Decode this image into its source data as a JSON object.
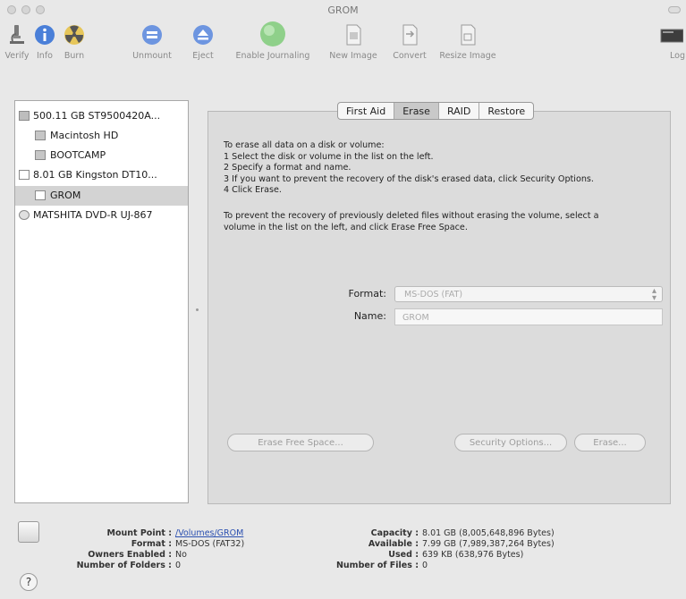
{
  "window": {
    "title": "GROM"
  },
  "toolbar": {
    "verify": "Verify",
    "info": "Info",
    "burn": "Burn",
    "unmount": "Unmount",
    "eject": "Eject",
    "enable_journaling": "Enable Journaling",
    "new_image": "New Image",
    "convert": "Convert",
    "resize_image": "Resize Image",
    "log": "Log"
  },
  "sidebar": {
    "items": [
      {
        "label": "500.11 GB ST9500420A..."
      },
      {
        "label": "Macintosh HD"
      },
      {
        "label": "BOOTCAMP"
      },
      {
        "label": "8.01 GB Kingston DT10..."
      },
      {
        "label": "GROM"
      },
      {
        "label": "MATSHITA DVD-R UJ-867"
      }
    ]
  },
  "tabs": [
    "First Aid",
    "Erase",
    "RAID",
    "Restore"
  ],
  "erase": {
    "instructions": [
      "To erase all data on a disk or volume:",
      "1 Select the disk or volume in the list on the left.",
      "2 Specify a format and name.",
      "3 If you want to prevent the recovery of the disk's erased data, click Security Options.",
      "4 Click Erase."
    ],
    "free_space_note": [
      "To prevent the recovery of previously deleted files without erasing the volume, select a",
      "volume in the list on the left, and click Erase Free Space."
    ],
    "format_label": "Format:",
    "format_value": "MS-DOS (FAT)",
    "name_label": "Name:",
    "name_value": "GROM",
    "erase_free_space_button": "Erase Free Space...",
    "security_options_button": "Security Options...",
    "erase_button": "Erase..."
  },
  "info": {
    "mount_point_label": "Mount Point :",
    "mount_point_value": "/Volumes/GROM",
    "format_label": "Format :",
    "format_value": "MS-DOS (FAT32)",
    "owners_label": "Owners Enabled :",
    "owners_value": "No",
    "folders_label": "Number of Folders :",
    "folders_value": "0",
    "capacity_label": "Capacity :",
    "capacity_value": "8.01 GB (8,005,648,896 Bytes)",
    "available_label": "Available :",
    "available_value": "7.99 GB (7,989,387,264 Bytes)",
    "used_label": "Used :",
    "used_value": "639 KB (638,976 Bytes)",
    "files_label": "Number of Files :",
    "files_value": "0"
  },
  "help": {
    "label": "?"
  },
  "colors": {
    "journaling_green": "#8fd08a",
    "info_blue": "#4a7fd8",
    "burn_yellow": "#e6c65a"
  }
}
